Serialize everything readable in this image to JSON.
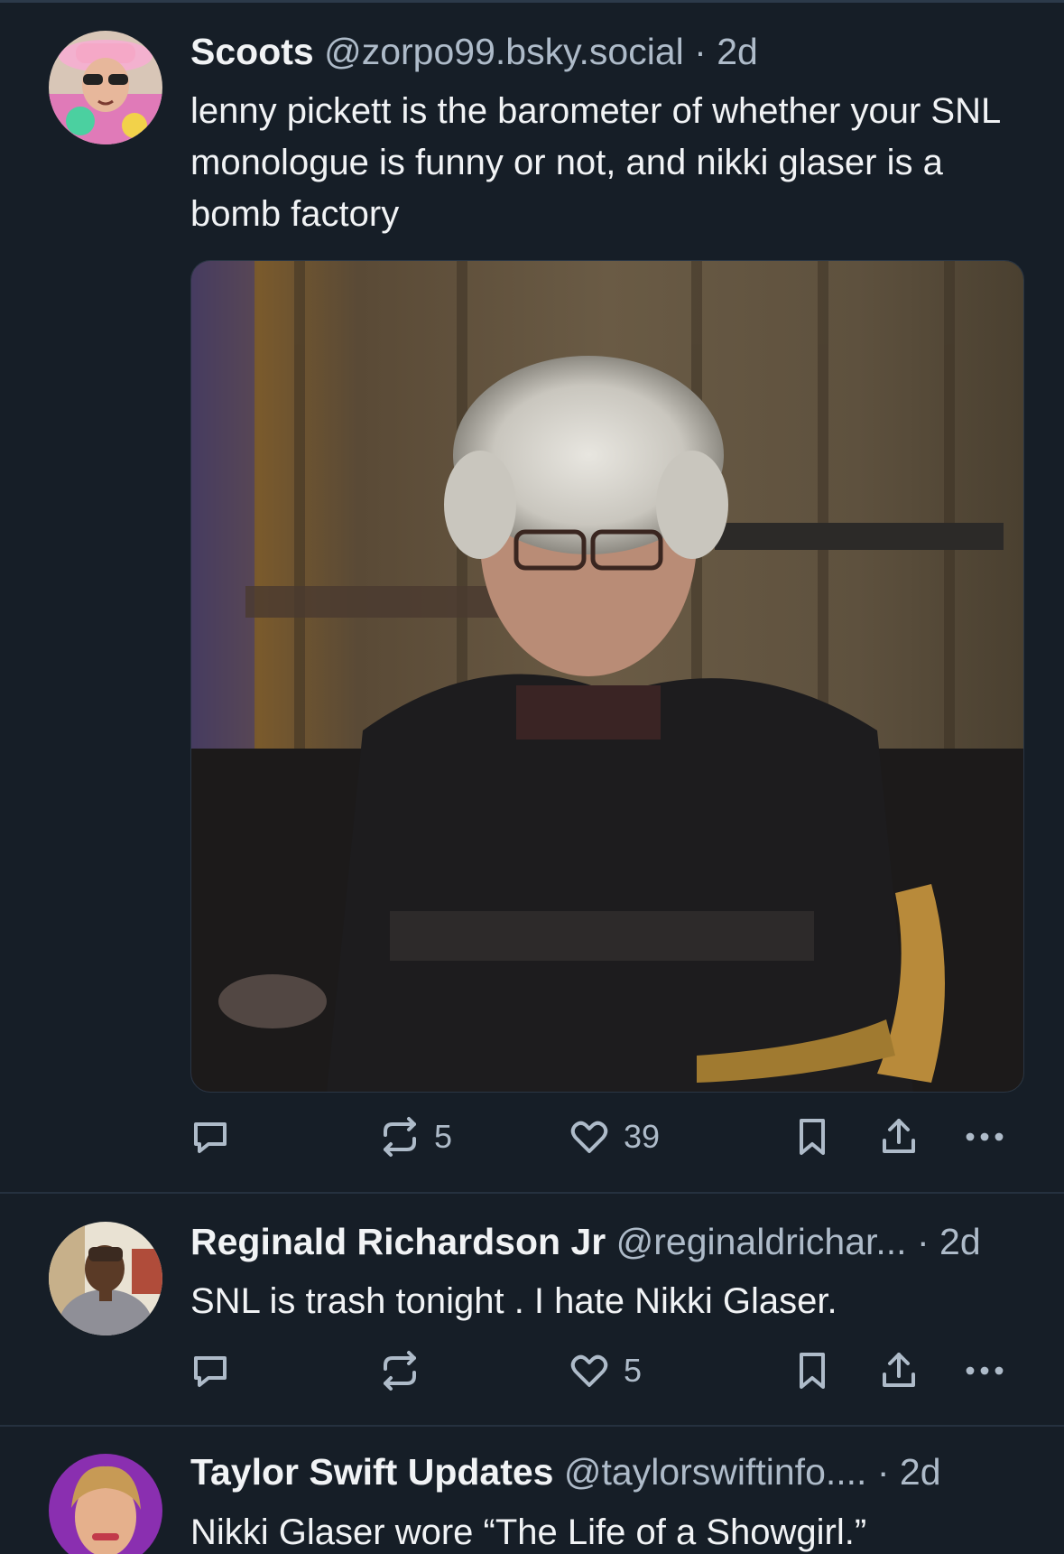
{
  "posts": [
    {
      "author": "Scoots",
      "handle": "@zorpo99.bsky.social",
      "time": "· 2d",
      "text": "lenny pickett is the barometer of whether your SNL monologue is funny or not, and nikki glaser is a bomb factory",
      "reposts": "5",
      "likes": "39"
    },
    {
      "author": "Reginald Richardson Jr",
      "handle": "@reginaldrichar...",
      "time": "· 2d",
      "text": "SNL is trash tonight . I hate Nikki Glaser.",
      "reposts": "",
      "likes": "5"
    },
    {
      "author": "Taylor Swift Updates",
      "handle": "@taylorswiftinfo....",
      "time": "· 2d",
      "text": "Nikki Glaser wore “The Life of a Showgirl.”"
    }
  ],
  "colors": {
    "background": "#161e27",
    "muted": "#aebbc9",
    "divider": "#25313f"
  },
  "icons": [
    "reply-icon",
    "repost-icon",
    "like-icon",
    "bookmark-icon",
    "share-icon",
    "more-icon"
  ]
}
